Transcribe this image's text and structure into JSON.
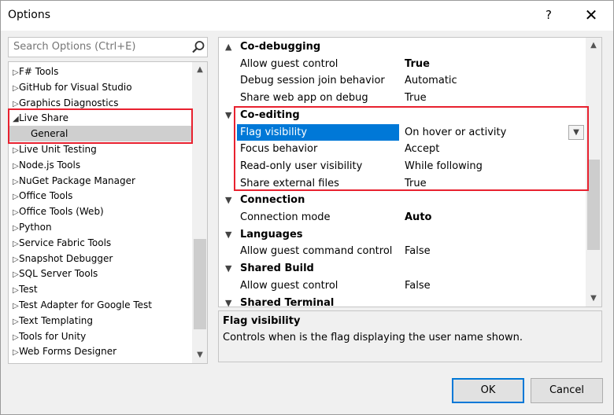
{
  "window": {
    "title": "Options",
    "help_label": "?",
    "close_label": "✕"
  },
  "search": {
    "placeholder": "Search Options (Ctrl+E)"
  },
  "tree": {
    "items": [
      {
        "label": "F# Tools",
        "arrow": "▷"
      },
      {
        "label": "GitHub for Visual Studio",
        "arrow": "▷"
      },
      {
        "label": "Graphics Diagnostics",
        "arrow": "▷"
      },
      {
        "label": "Live Share",
        "arrow": "◢"
      },
      {
        "label": "General",
        "arrow": ""
      },
      {
        "label": "Live Unit Testing",
        "arrow": "▷"
      },
      {
        "label": "Node.js Tools",
        "arrow": "▷"
      },
      {
        "label": "NuGet Package Manager",
        "arrow": "▷"
      },
      {
        "label": "Office Tools",
        "arrow": "▷"
      },
      {
        "label": "Office Tools (Web)",
        "arrow": "▷"
      },
      {
        "label": "Python",
        "arrow": "▷"
      },
      {
        "label": "Service Fabric Tools",
        "arrow": "▷"
      },
      {
        "label": "Snapshot Debugger",
        "arrow": "▷"
      },
      {
        "label": "SQL Server Tools",
        "arrow": "▷"
      },
      {
        "label": "Test",
        "arrow": "▷"
      },
      {
        "label": "Test Adapter for Google Test",
        "arrow": "▷"
      },
      {
        "label": "Text Templating",
        "arrow": "▷"
      },
      {
        "label": "Tools for Unity",
        "arrow": "▷"
      },
      {
        "label": "Web Forms Designer",
        "arrow": "▷"
      }
    ],
    "scroll_up": "▲",
    "scroll_down": "▼"
  },
  "grid": {
    "rows": [
      {
        "type": "category",
        "chevron": "▲",
        "label": "Co-debugging"
      },
      {
        "type": "property",
        "name": "Allow guest control",
        "value": "True",
        "bold": true
      },
      {
        "type": "property",
        "name": "Debug session join behavior",
        "value": "Automatic"
      },
      {
        "type": "property",
        "name": "Share web app on debug",
        "value": "True"
      },
      {
        "type": "category",
        "chevron": "▼",
        "label": "Co-editing"
      },
      {
        "type": "property",
        "name": "Flag visibility",
        "value": "On hover or activity",
        "selected": true,
        "dropdown": "▼"
      },
      {
        "type": "property",
        "name": "Focus behavior",
        "value": "Accept"
      },
      {
        "type": "property",
        "name": "Read-only user visibility",
        "value": "While following"
      },
      {
        "type": "property",
        "name": "Share external files",
        "value": "True"
      },
      {
        "type": "category",
        "chevron": "▼",
        "label": "Connection"
      },
      {
        "type": "property",
        "name": "Connection mode",
        "value": "Auto",
        "bold": true
      },
      {
        "type": "category",
        "chevron": "▼",
        "label": "Languages"
      },
      {
        "type": "property",
        "name": "Allow guest command control",
        "value": "False"
      },
      {
        "type": "category",
        "chevron": "▼",
        "label": "Shared Build"
      },
      {
        "type": "property",
        "name": "Allow guest control",
        "value": "False"
      },
      {
        "type": "category",
        "chevron": "▼",
        "label": "Shared Terminal"
      }
    ],
    "scroll_up": "▲",
    "scroll_down": "▼"
  },
  "description": {
    "title": "Flag visibility",
    "text": "Controls when is the flag displaying the user name shown."
  },
  "buttons": {
    "ok": "OK",
    "cancel": "Cancel"
  },
  "colors": {
    "accent": "#0078d7",
    "highlight": "#e8212f",
    "selected_tree": "#cfcfcf"
  }
}
